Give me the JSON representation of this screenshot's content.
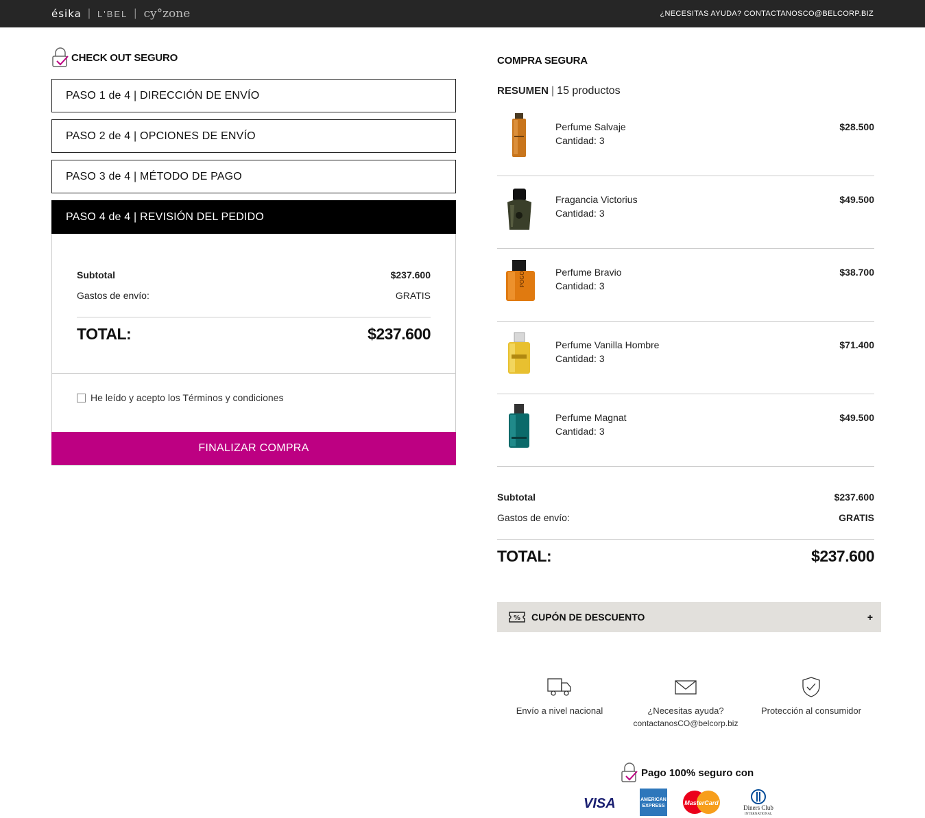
{
  "header": {
    "brand_esika": "ésika",
    "brand_lbel": "L'BEL",
    "brand_cyzone": "cy°zone",
    "help": "¿NECESITAS AYUDA? CONTACTANOSCO@BELCORP.BIZ"
  },
  "checkout": {
    "title": "CHECK OUT SEGURO",
    "steps": [
      {
        "label": "PASO 1 de 4 | DIRECCIÓN DE ENVÍO",
        "active": false
      },
      {
        "label": "PASO 2 de 4 | OPCIONES DE ENVÍO",
        "active": false
      },
      {
        "label": "PASO 3 de 4 | MÉTODO DE PAGO",
        "active": false
      },
      {
        "label": "PASO 4 de 4 | REVISIÓN DEL PEDIDO",
        "active": true
      }
    ],
    "review": {
      "subtotal_label": "Subtotal",
      "subtotal_value": "$237.600",
      "shipping_label": "Gastos de envío:",
      "shipping_value": "GRATIS",
      "total_label": "TOTAL:",
      "total_value": "$237.600"
    },
    "terms_label": "He leído y acepto los Términos y condiciones",
    "terms_checked": false,
    "finalize_label": "FINALIZAR COMPRA",
    "finalize_color": "#bd0082"
  },
  "summary": {
    "title": "COMPRA SEGURA",
    "resumen_label": "RESUMEN",
    "count_label": "15 productos",
    "products": [
      {
        "name": "Perfume Salvaje",
        "qty": "Cantidad: 3",
        "price": "$28.500",
        "icon": "perfume-bottle-amber-tall"
      },
      {
        "name": "Fragancia Victorius",
        "qty": "Cantidad: 3",
        "price": "$49.500",
        "icon": "perfume-bottle-dark-green"
      },
      {
        "name": "Perfume Bravio",
        "qty": "Cantidad: 3",
        "price": "$38.700",
        "icon": "perfume-bottle-orange"
      },
      {
        "name": "Perfume Vanilla Hombre",
        "qty": "Cantidad: 3",
        "price": "$71.400",
        "icon": "perfume-bottle-yellow"
      },
      {
        "name": "Perfume Magnat",
        "qty": "Cantidad: 3",
        "price": "$49.500",
        "icon": "perfume-bottle-teal"
      }
    ],
    "subtotal_label": "Subtotal",
    "subtotal_value": "$237.600",
    "shipping_label": "Gastos de envío:",
    "shipping_value": "GRATIS",
    "total_label": "TOTAL:",
    "total_value": "$237.600",
    "coupon_label": "CUPÓN DE DESCUENTO",
    "coupon_toggle": "+"
  },
  "features": {
    "shipping": "Envío a nivel nacional",
    "help_title": "¿Necesitas ayuda?",
    "help_email": "contactanosCO@belcorp.biz",
    "protection": "Protección al consumidor"
  },
  "payment": {
    "title": "Pago 100% seguro con",
    "visa": "VISA",
    "amex_line1": "AMERICAN",
    "amex_line2": "EXPRESS",
    "mastercard": "MasterCard",
    "diners_line1": "Diners Club",
    "diners_line2": "INTERNATIONAL"
  }
}
